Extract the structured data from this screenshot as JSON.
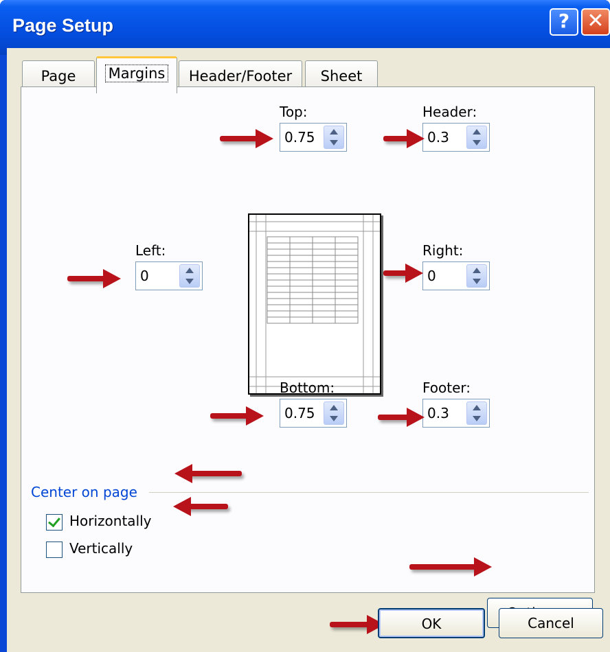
{
  "window": {
    "title": "Page Setup",
    "help_button": "?",
    "close_button": "✕"
  },
  "tabs": [
    {
      "label": "Page",
      "active": false
    },
    {
      "label": "Margins",
      "active": true
    },
    {
      "label": "Header/Footer",
      "active": false
    },
    {
      "label": "Sheet",
      "active": false
    }
  ],
  "margins": {
    "top": {
      "label": "Top:",
      "value": "0.75",
      "mnemonic": "T"
    },
    "header": {
      "label": "Header:",
      "value": "0.3",
      "mnemonic": "A"
    },
    "left": {
      "label": "Left:",
      "value": "0",
      "mnemonic": "L"
    },
    "right": {
      "label": "Right:",
      "value": "0",
      "mnemonic": "R"
    },
    "bottom": {
      "label": "Bottom:",
      "value": "0.75",
      "mnemonic": "B"
    },
    "footer": {
      "label": "Footer:",
      "value": "0.3",
      "mnemonic": "F"
    }
  },
  "center_on_page": {
    "label": "Center on page",
    "horizontally": {
      "label": "Horizontally",
      "checked": true
    },
    "vertically": {
      "label": "Vertically",
      "checked": false
    }
  },
  "buttons": {
    "options": "Options...",
    "ok": "OK",
    "cancel": "Cancel"
  },
  "colors": {
    "titlebar": "#0551e4",
    "dialog_bg": "#ece9d8",
    "panel_bg": "#fcfcfe",
    "group_label": "#0046d5",
    "annotation_arrow": "#b8121a",
    "checkmark": "#21a121"
  },
  "annotations": {
    "arrow_icon": "red-arrow-icon",
    "count": 11
  }
}
